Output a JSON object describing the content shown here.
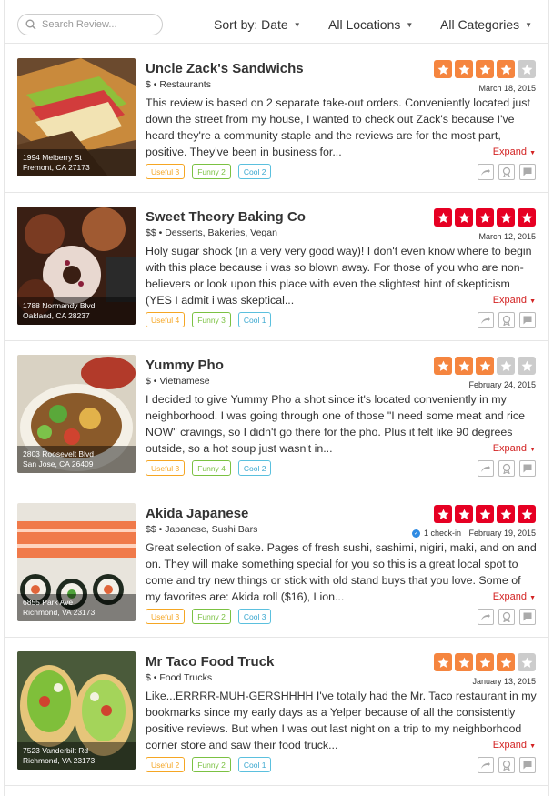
{
  "toolbar": {
    "search_placeholder": "Search Review...",
    "sort_label": "Sort by: Date",
    "locations_label": "All Locations",
    "categories_label": "All Categories"
  },
  "colors": {
    "accent": "#d32323",
    "star_orange": "#f5853f",
    "star_red": "#e60023",
    "star_empty": "#cccccc"
  },
  "reviews": [
    {
      "name": "Uncle Zack's Sandwichs",
      "price": "$",
      "categories": "Restaurants",
      "address_line1": "1994 Melberry St",
      "address_line2": "Fremont, CA 27173",
      "rating": 4,
      "star_color": "#f5853f",
      "date": "March 18, 2015",
      "checkin": "",
      "text": "This review is based on 2 separate take-out orders. Conveniently located just down the street from my house, I wanted to check out Zack's because I've heard they're a community staple and the reviews are for the most part, positive. They've been in business for...",
      "useful": "Useful 3",
      "funny": "Funny 2",
      "cool": "Cool 2",
      "image": "sandwich"
    },
    {
      "name": "Sweet Theory Baking Co",
      "price": "$$",
      "categories": "Desserts, Bakeries, Vegan",
      "address_line1": "1788 Normandy Blvd",
      "address_line2": "Oakland, CA 28237",
      "rating": 5,
      "star_color": "#e60023",
      "date": "March 12, 2015",
      "checkin": "",
      "text": "Holy sugar shock (in a very very good way)! I don't even know where to begin with this place because i was so blown away. For those of you who are non-believers or look upon this place with even the slightest hint of skepticism (YES I admit i was skeptical...",
      "useful": "Useful 4",
      "funny": "Funny 3",
      "cool": "Cool 1",
      "image": "donuts"
    },
    {
      "name": "Yummy Pho",
      "price": "$",
      "categories": "Vietnamese",
      "address_line1": "2803 Roosevelt Blvd",
      "address_line2": "San Jose, CA 26409",
      "rating": 3,
      "star_color": "#f5853f",
      "date": "February 24, 2015",
      "checkin": "",
      "text": "I decided to give Yummy Pho a shot since it's located conveniently in my neighborhood. I was going through one of those \"I need some meat and rice NOW\" cravings, so I didn't go there for the pho. Plus it felt like 90 degrees outside, so a hot soup just wasn't in...",
      "useful": "Useful 3",
      "funny": "Funny 4",
      "cool": "Cool 2",
      "image": "pho"
    },
    {
      "name": "Akida Japanese",
      "price": "$$",
      "categories": "Japanese, Sushi Bars",
      "address_line1": "6855 Park Ave",
      "address_line2": "Richmond, VA 23173",
      "rating": 5,
      "star_color": "#e60023",
      "date": "February 19, 2015",
      "checkin": "1 check-in",
      "text": "Great selection of sake. Pages of fresh sushi, sashimi, nigiri, maki, and on and on. They will make something special for you so this is a great local spot to come and try new things or stick with old stand buys that you love. Some of my favorites are: Akida roll ($16), Lion...",
      "useful": "Useful 3",
      "funny": "Funny 2",
      "cool": "Cool 3",
      "image": "sushi"
    },
    {
      "name": "Mr Taco Food Truck",
      "price": "$",
      "categories": "Food Trucks",
      "address_line1": "7523 Vanderbilt Rd",
      "address_line2": "Richmond, VA 23173",
      "rating": 4,
      "star_color": "#f5853f",
      "date": "January 13, 2015",
      "checkin": "",
      "text": "Like...ERRRR-MUH-GERSHHHH I've totally had the Mr. Taco restaurant in my bookmarks since my early days as a Yelper because of all the consistently positive reviews. But when I was out last night on a trip to my neighborhood corner store and saw their food truck...",
      "useful": "Useful 2",
      "funny": "Funny 2",
      "cool": "Cool 1",
      "image": "tacos"
    }
  ],
  "expand_label": "Expand"
}
